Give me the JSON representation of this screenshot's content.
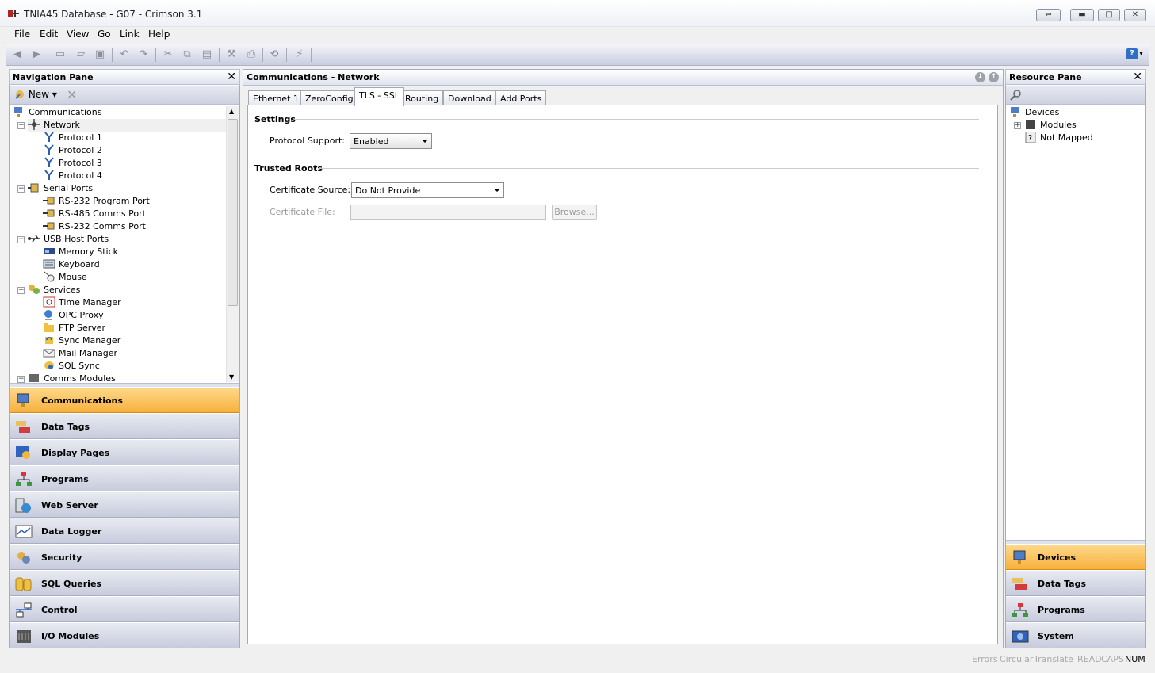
{
  "window": {
    "title": "TNIA45 Database - G07 - Crimson 3.1",
    "app_icon": "crimson-app-icon"
  },
  "menu": [
    "File",
    "Edit",
    "View",
    "Go",
    "Link",
    "Help"
  ],
  "navigation_pane": {
    "title": "Navigation Pane",
    "new_label": "New",
    "tree": [
      {
        "label": "Communications",
        "icon": "communications-icon"
      },
      {
        "label": "Network",
        "icon": "network-icon"
      },
      {
        "label": "Protocol 1",
        "icon": "protocol-icon"
      },
      {
        "label": "Protocol 2",
        "icon": "protocol-icon"
      },
      {
        "label": "Protocol 3",
        "icon": "protocol-icon"
      },
      {
        "label": "Protocol 4",
        "icon": "protocol-icon"
      },
      {
        "label": "Serial Ports",
        "icon": "serial-ports-icon"
      },
      {
        "label": "RS-232 Program Port",
        "icon": "serial-port-icon"
      },
      {
        "label": "RS-485 Comms Port",
        "icon": "serial-port-icon"
      },
      {
        "label": "RS-232 Comms Port",
        "icon": "serial-port-icon"
      },
      {
        "label": "USB Host Ports",
        "icon": "usb-icon"
      },
      {
        "label": "Memory Stick",
        "icon": "memory-stick-icon"
      },
      {
        "label": "Keyboard",
        "icon": "keyboard-icon"
      },
      {
        "label": "Mouse",
        "icon": "mouse-icon"
      },
      {
        "label": "Services",
        "icon": "services-icon"
      },
      {
        "label": "Time Manager",
        "icon": "time-manager-icon"
      },
      {
        "label": "OPC Proxy",
        "icon": "opc-proxy-icon"
      },
      {
        "label": "FTP Server",
        "icon": "ftp-server-icon"
      },
      {
        "label": "Sync Manager",
        "icon": "sync-manager-icon"
      },
      {
        "label": "Mail Manager",
        "icon": "mail-manager-icon"
      },
      {
        "label": "SQL Sync",
        "icon": "sql-sync-icon"
      },
      {
        "label": "Comms Modules",
        "icon": "comms-modules-icon"
      }
    ],
    "categories": [
      {
        "label": "Communications",
        "icon": "communications-icon",
        "active": true
      },
      {
        "label": "Data Tags",
        "icon": "data-tags-icon"
      },
      {
        "label": "Display Pages",
        "icon": "display-pages-icon"
      },
      {
        "label": "Programs",
        "icon": "programs-icon"
      },
      {
        "label": "Web Server",
        "icon": "web-server-icon"
      },
      {
        "label": "Data Logger",
        "icon": "data-logger-icon"
      },
      {
        "label": "Security",
        "icon": "security-icon"
      },
      {
        "label": "SQL Queries",
        "icon": "sql-queries-icon"
      },
      {
        "label": "Control",
        "icon": "control-icon"
      },
      {
        "label": "I/O Modules",
        "icon": "io-modules-icon"
      }
    ]
  },
  "editor": {
    "title": "Communications - Network",
    "tabs": [
      "Ethernet 1",
      "ZeroConfig",
      "TLS - SSL",
      "Routing",
      "Download",
      "Add Ports"
    ],
    "active_tab": "TLS - SSL",
    "settings": {
      "header": "Settings",
      "protocol_support_label": "Protocol Support:",
      "protocol_support_value": "Enabled"
    },
    "trusted_roots": {
      "header": "Trusted Roots",
      "cert_source_label": "Certificate Source:",
      "cert_source_value": "Do Not Provide",
      "cert_file_label": "Certificate File:",
      "cert_file_value": "",
      "browse_label": "Browse..."
    }
  },
  "resource_pane": {
    "title": "Resource Pane",
    "tree": [
      {
        "label": "Devices",
        "icon": "devices-icon"
      },
      {
        "label": "Modules",
        "icon": "modules-icon"
      },
      {
        "label": "Not Mapped",
        "icon": "question-icon"
      }
    ],
    "categories": [
      {
        "label": "Devices",
        "icon": "devices-icon",
        "active": true
      },
      {
        "label": "Data Tags",
        "icon": "data-tags-icon"
      },
      {
        "label": "Programs",
        "icon": "programs-icon"
      },
      {
        "label": "System",
        "icon": "system-icon"
      }
    ]
  },
  "status": {
    "items": [
      "Errors",
      "Circular",
      "Translate",
      "READ",
      "CAPS",
      "NUM"
    ],
    "active": "NUM"
  },
  "colors": {
    "active_category": "#f6b13d",
    "category": "#d3d6e4"
  }
}
